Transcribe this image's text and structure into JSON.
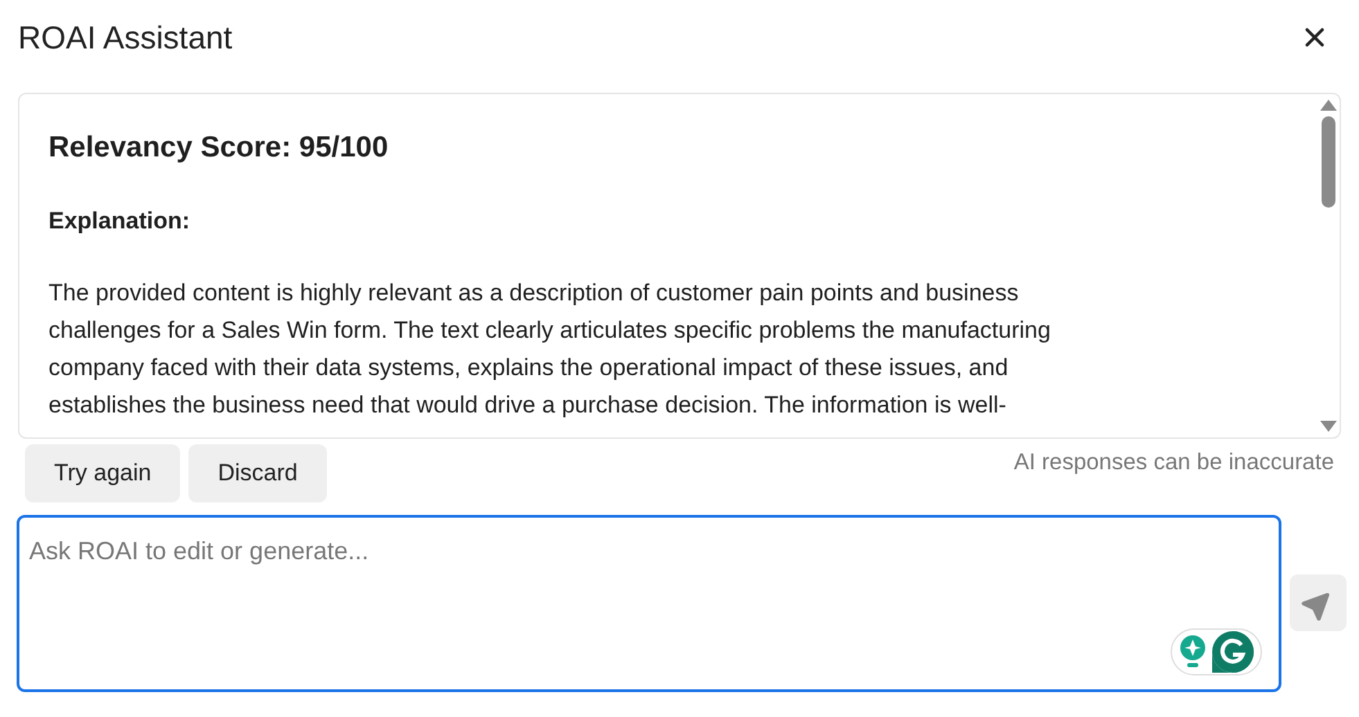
{
  "window": {
    "title": "ROAI Assistant"
  },
  "response": {
    "heading": "Relevancy Score: 95/100",
    "subheading": "Explanation:",
    "lines": [
      "The provided content is highly relevant as a description of customer pain points and business",
      "challenges for a Sales Win form. The text clearly articulates specific problems the manufacturing",
      "company faced with their data systems, explains the operational impact of these issues, and",
      "establishes the business need that would drive a purchase decision. The information is well-"
    ]
  },
  "actions": [
    "Try again",
    "Discard"
  ],
  "disclaimer": "AI responses can be inaccurate",
  "prompt": {
    "placeholder": "Ask ROAI to edit or generate..."
  }
}
